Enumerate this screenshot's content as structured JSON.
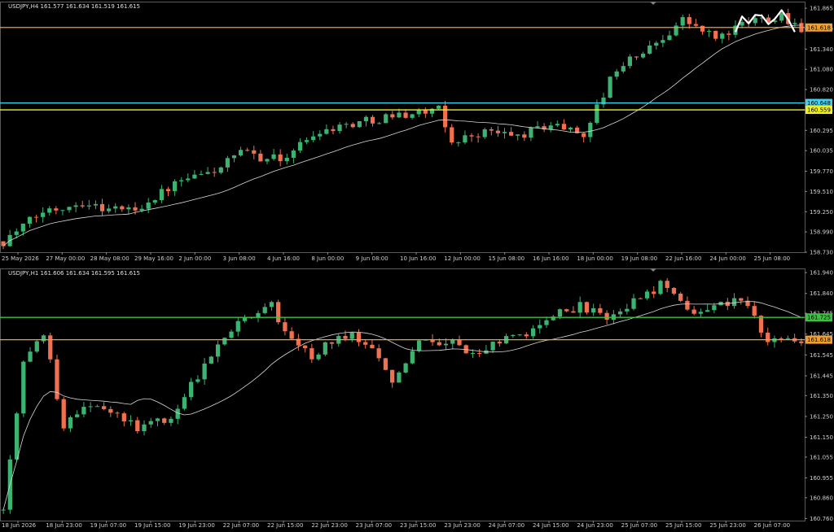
{
  "chart_data": [
    {
      "type": "candlestick",
      "header": "USDJPY,H4  161.577 161.634 161.519 161.615",
      "ylim": [
        158.73,
        161.95
      ],
      "y_ticks": [
        "161.865",
        "161.600",
        "161.340",
        "161.080",
        "160.820",
        "160.555",
        "160.295",
        "160.035",
        "159.770",
        "159.510",
        "159.250",
        "158.990",
        "158.730"
      ],
      "x_ticks": [
        "25 May 2026",
        "27 May 00:00",
        "28 May 08:00",
        "29 May 16:00",
        "2 Jun 00:00",
        "3 Jun 08:00",
        "4 Jun 16:00",
        "8 Jun 00:00",
        "9 Jun 08:00",
        "10 Jun 16:00",
        "12 Jun 00:00",
        "15 Jun 08:00",
        "16 Jun 16:00",
        "18 Jun 00:00",
        "19 Jun 08:00",
        "22 Jun 16:00",
        "24 Jun 00:00",
        "25 Jun 08:00"
      ],
      "levels": [
        {
          "value": 161.618,
          "label": "161.618",
          "color": "#f0a030"
        },
        {
          "value": 160.648,
          "label": "160.648",
          "color": "#40d0f0"
        },
        {
          "value": 160.559,
          "label": "160.559",
          "color": "#f0f020"
        }
      ],
      "ma_color": "#d8d8d8",
      "up_color": "#3cb371",
      "down_color": "#f07050",
      "pattern_overlay": {
        "color": "#ffffff",
        "points": [
          [
            111,
            161.56
          ],
          [
            112,
            161.76
          ],
          [
            113,
            161.67
          ],
          [
            114,
            161.78
          ],
          [
            115,
            161.77
          ],
          [
            116,
            161.66
          ],
          [
            117,
            161.73
          ],
          [
            118,
            161.84
          ],
          [
            119,
            161.72
          ],
          [
            120,
            161.56
          ]
        ]
      },
      "anchors": [
        [
          0,
          158.87
        ],
        [
          6,
          159.25
        ],
        [
          12,
          159.38
        ],
        [
          15,
          159.3
        ],
        [
          20,
          159.28
        ],
        [
          26,
          159.6
        ],
        [
          32,
          159.78
        ],
        [
          36,
          160.0
        ],
        [
          42,
          159.92
        ],
        [
          48,
          160.3
        ],
        [
          55,
          160.42
        ],
        [
          60,
          160.5
        ],
        [
          66,
          160.55
        ],
        [
          68,
          160.15
        ],
        [
          73,
          160.28
        ],
        [
          78,
          160.22
        ],
        [
          83,
          160.38
        ],
        [
          88,
          160.25
        ],
        [
          93,
          161.1
        ],
        [
          98,
          161.35
        ],
        [
          103,
          161.72
        ],
        [
          108,
          161.48
        ],
        [
          114,
          161.72
        ],
        [
          118,
          161.78
        ],
        [
          121,
          161.615
        ]
      ]
    },
    {
      "type": "candlestick",
      "header": "USDJPY,H1  161.606 161.634 161.595 161.615",
      "ylim": [
        160.75,
        161.96
      ],
      "y_ticks": [
        "161.940",
        "161.840",
        "161.745",
        "161.645",
        "161.545",
        "161.445",
        "161.350",
        "161.250",
        "161.150",
        "161.055",
        "160.955",
        "160.860",
        "160.760"
      ],
      "x_ticks": [
        "18 Jun 2026",
        "18 Jun 23:00",
        "19 Jun 07:00",
        "19 Jun 15:00",
        "19 Jun 23:00",
        "22 Jun 07:00",
        "22 Jun 15:00",
        "22 Jun 23:00",
        "23 Jun 07:00",
        "23 Jun 15:00",
        "23 Jun 23:00",
        "24 Jun 07:00",
        "24 Jun 15:00",
        "24 Jun 23:00",
        "25 Jun 07:00",
        "25 Jun 15:00",
        "25 Jun 23:00",
        "26 Jun 07:00"
      ],
      "levels": [
        {
          "value": 161.725,
          "label": "161.725",
          "color": "#40c040"
        },
        {
          "value": 161.618,
          "label": "161.618",
          "color": "#f0a030"
        }
      ],
      "ma_color": "#d8d8d8",
      "up_color": "#3cb371",
      "down_color": "#f07050",
      "anchors": [
        [
          0,
          160.8
        ],
        [
          3,
          161.5
        ],
        [
          6,
          161.65
        ],
        [
          9,
          161.2
        ],
        [
          12,
          161.3
        ],
        [
          16,
          161.27
        ],
        [
          20,
          161.2
        ],
        [
          25,
          161.24
        ],
        [
          30,
          161.5
        ],
        [
          35,
          161.72
        ],
        [
          40,
          161.78
        ],
        [
          42,
          161.65
        ],
        [
          46,
          161.54
        ],
        [
          50,
          161.65
        ],
        [
          55,
          161.6
        ],
        [
          58,
          161.43
        ],
        [
          62,
          161.6
        ],
        [
          66,
          161.62
        ],
        [
          70,
          161.55
        ],
        [
          75,
          161.62
        ],
        [
          78,
          161.65
        ],
        [
          82,
          161.74
        ],
        [
          86,
          161.78
        ],
        [
          90,
          161.72
        ],
        [
          94,
          161.8
        ],
        [
          98,
          161.88
        ],
        [
          102,
          161.75
        ],
        [
          106,
          161.78
        ],
        [
          110,
          161.82
        ],
        [
          112,
          161.72
        ],
        [
          114,
          161.6
        ],
        [
          118,
          161.615
        ]
      ]
    }
  ]
}
